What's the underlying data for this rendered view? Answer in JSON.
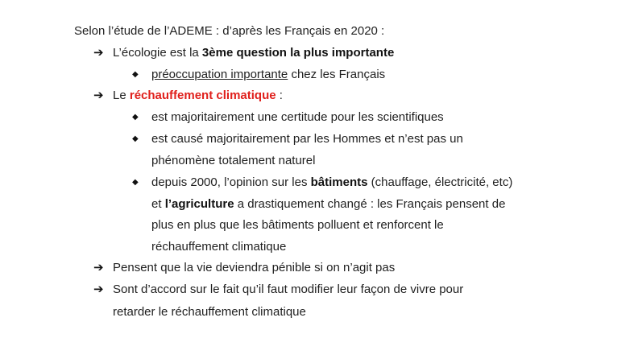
{
  "intro": "Selon l’étude de l’ADEME : d’après les Français en 2020 :",
  "item1": {
    "pre": "L’écologie est la ",
    "bold": "3ème question la plus importante",
    "sub1": {
      "underlined": "préoccupation importante",
      "post": " chez les Français"
    }
  },
  "item2": {
    "pre": "Le ",
    "red": "réchauffement climatique",
    "post": " :",
    "sub1": " est majoritairement une certitude pour les scientifiques",
    "sub2": {
      "line1": "est causé majoritairement par les Hommes et n’est pas un",
      "line2": "phénomène totalement naturel"
    },
    "sub3": {
      "line1_pre": "depuis 2000, l’opinion sur les ",
      "line1_bold": "bâtiments",
      "line1_post": " (chauffage, électricité, etc)",
      "line2_pre": "et ",
      "line2_bold": "l’agriculture",
      "line2_post": " a drastiquement changé : les Français pensent de",
      "line3": "plus en plus que les bâtiments polluent et renforcent le",
      "line4": "réchauffement climatique"
    }
  },
  "item3": "Pensent que la vie deviendra pénible si on n’agit pas",
  "item4": {
    "line1": "Sont d’accord sur le fait qu’il faut modifier leur façon de vivre pour",
    "line2": "retarder le réchauffement climatique"
  },
  "icons": {
    "arrow": "arrow-right-icon",
    "diamond": "diamond-bullet-icon"
  },
  "colors": {
    "text": "#1f1f1f",
    "highlight_red": "#e0201c"
  }
}
